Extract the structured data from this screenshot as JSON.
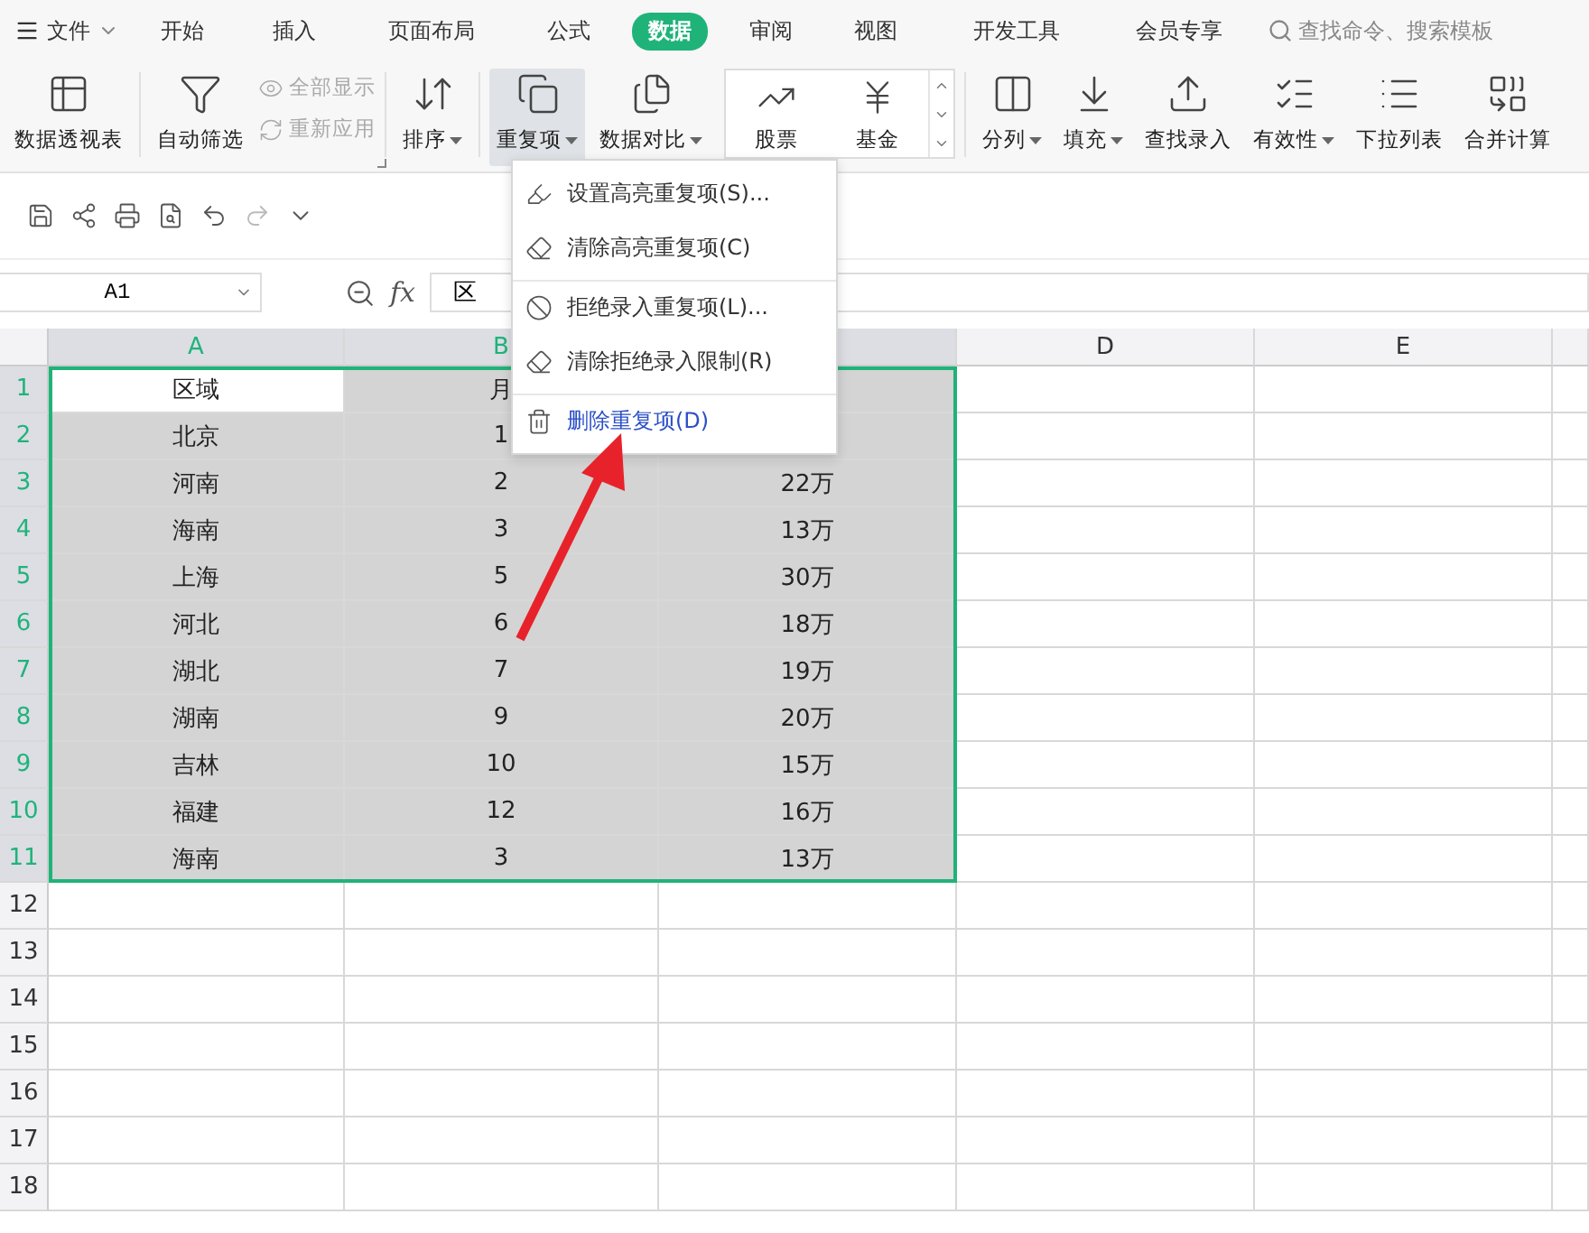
{
  "menu_bar": {
    "file_label": "文件",
    "tabs": [
      {
        "label": "开始",
        "selected": false
      },
      {
        "label": "插入",
        "selected": false
      },
      {
        "label": "页面布局",
        "selected": false
      },
      {
        "label": "公式",
        "selected": false
      },
      {
        "label": "数据",
        "selected": true
      },
      {
        "label": "审阅",
        "selected": false
      },
      {
        "label": "视图",
        "selected": false
      },
      {
        "label": "开发工具",
        "selected": false
      },
      {
        "label": "会员专享",
        "selected": false
      }
    ],
    "search": {
      "placeholder": "查找命令、搜索模板"
    }
  },
  "ribbon": [
    {
      "kind": "large",
      "label": "数据透视表",
      "selected": false,
      "divider_after": true
    },
    {
      "kind": "large",
      "label": "自动筛选",
      "selected": false
    },
    {
      "kind": "stack",
      "items": [
        {
          "label": "全部显示",
          "disabled": true
        },
        {
          "label": "重新应用",
          "disabled": true
        }
      ],
      "divider_after": true
    },
    {
      "kind": "large",
      "label": "排序",
      "caret": true,
      "selected": false,
      "divider_after": true
    },
    {
      "kind": "large",
      "label": "重复项",
      "caret": true,
      "selected": true
    },
    {
      "kind": "large",
      "label": "数据对比",
      "caret": true,
      "selected": false
    },
    {
      "kind": "gallery",
      "items": [
        {
          "label": "股票"
        },
        {
          "label": "基金"
        }
      ],
      "divider_after": true
    },
    {
      "kind": "large",
      "label": "分列",
      "caret": true,
      "selected": false
    },
    {
      "kind": "large",
      "label": "填充",
      "caret": true,
      "selected": false
    },
    {
      "kind": "large",
      "label": "查找录入",
      "selected": false
    },
    {
      "kind": "large",
      "label": "有效性",
      "caret": true,
      "selected": false
    },
    {
      "kind": "large",
      "label": "下拉列表",
      "selected": false
    },
    {
      "kind": "large",
      "label": "合并计算",
      "selected": false
    }
  ],
  "formula_bar": {
    "name_box": "A1",
    "function_label": "fx",
    "formula": "区"
  },
  "columns": [
    {
      "label": "A",
      "selected": true
    },
    {
      "label": "B",
      "selected": true
    },
    {
      "selected": true
    },
    {
      "label": "D",
      "selected": false
    },
    {
      "label": "E",
      "selected": false
    }
  ],
  "rows": [
    {
      "number": "1",
      "selected": true,
      "cells": [
        "区域",
        "月"
      ]
    },
    {
      "number": "2",
      "selected": true,
      "cells": [
        "北京",
        "1"
      ]
    },
    {
      "number": "3",
      "selected": true,
      "cells": [
        "河南",
        "2",
        "22万"
      ]
    },
    {
      "number": "4",
      "selected": true,
      "cells": [
        "海南",
        "3",
        "13万"
      ]
    },
    {
      "number": "5",
      "selected": true,
      "cells": [
        "上海",
        "5",
        "30万"
      ]
    },
    {
      "number": "6",
      "selected": true,
      "cells": [
        "河北",
        "6",
        "18万"
      ]
    },
    {
      "number": "7",
      "selected": true,
      "cells": [
        "湖北",
        "7",
        "19万"
      ]
    },
    {
      "number": "8",
      "selected": true,
      "cells": [
        "湖南",
        "9",
        "20万"
      ]
    },
    {
      "number": "9",
      "selected": true,
      "cells": [
        "吉林",
        "10",
        "15万"
      ]
    },
    {
      "number": "10",
      "selected": true,
      "cells": [
        "福建",
        "12",
        "16万"
      ]
    },
    {
      "number": "11",
      "selected": true,
      "cells": [
        "海南",
        "3",
        "13万"
      ]
    },
    {
      "number": "12",
      "selected": false
    },
    {
      "number": "13",
      "selected": false
    },
    {
      "number": "14",
      "selected": false
    },
    {
      "number": "15",
      "selected": false
    },
    {
      "number": "16",
      "selected": false
    },
    {
      "number": "17",
      "selected": false
    },
    {
      "number": "18",
      "selected": false
    }
  ],
  "dropdown_menu": {
    "items": [
      {
        "label": "设置高亮重复项(S)...",
        "divider_before": false,
        "selected": false
      },
      {
        "label": "清除高亮重复项(C)",
        "divider_before": false,
        "selected": false
      },
      {
        "label": "拒绝录入重复项(L)...",
        "divider_before": true,
        "selected": false
      },
      {
        "label": "清除拒绝录入限制(R)",
        "divider_before": false,
        "selected": false
      },
      {
        "label": "删除重复项(D)",
        "divider_before": true,
        "selected": true
      }
    ]
  }
}
